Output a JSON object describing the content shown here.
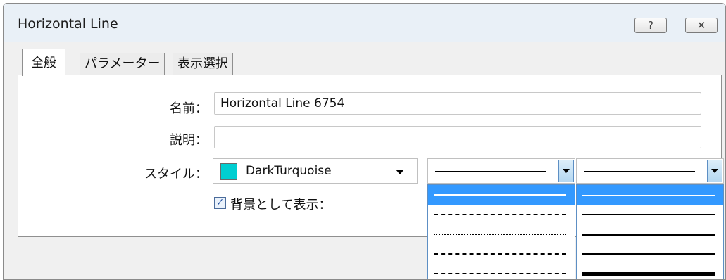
{
  "window": {
    "title": "Horizontal Line"
  },
  "titlebar_buttons": {
    "help": "?",
    "close": "✕"
  },
  "tabs": [
    {
      "label": "全般"
    },
    {
      "label": "パラメーター"
    },
    {
      "label": "表示選択"
    }
  ],
  "form": {
    "name_label": "名前：",
    "name_value": "Horizontal Line 6754",
    "description_label": "説明：",
    "description_value": "",
    "style_label": "スタイル：",
    "color_name": "DarkTurquoise",
    "color_hex": "#00ced1",
    "background_label": "背景として表示：",
    "background_checked": true
  },
  "line_style_dropdown": {
    "items": [
      "solid",
      "dash",
      "dot",
      "dash-dot",
      "dash-dot-dot"
    ],
    "selected_index": 0
  },
  "line_width_dropdown": {
    "items": [
      "1",
      "2",
      "3",
      "4",
      "5"
    ],
    "selected_index": 0
  },
  "colors": {
    "selection": "#3399ff",
    "titlebar": "#e9f0f7",
    "dialog_bg": "#f0f0f0"
  }
}
